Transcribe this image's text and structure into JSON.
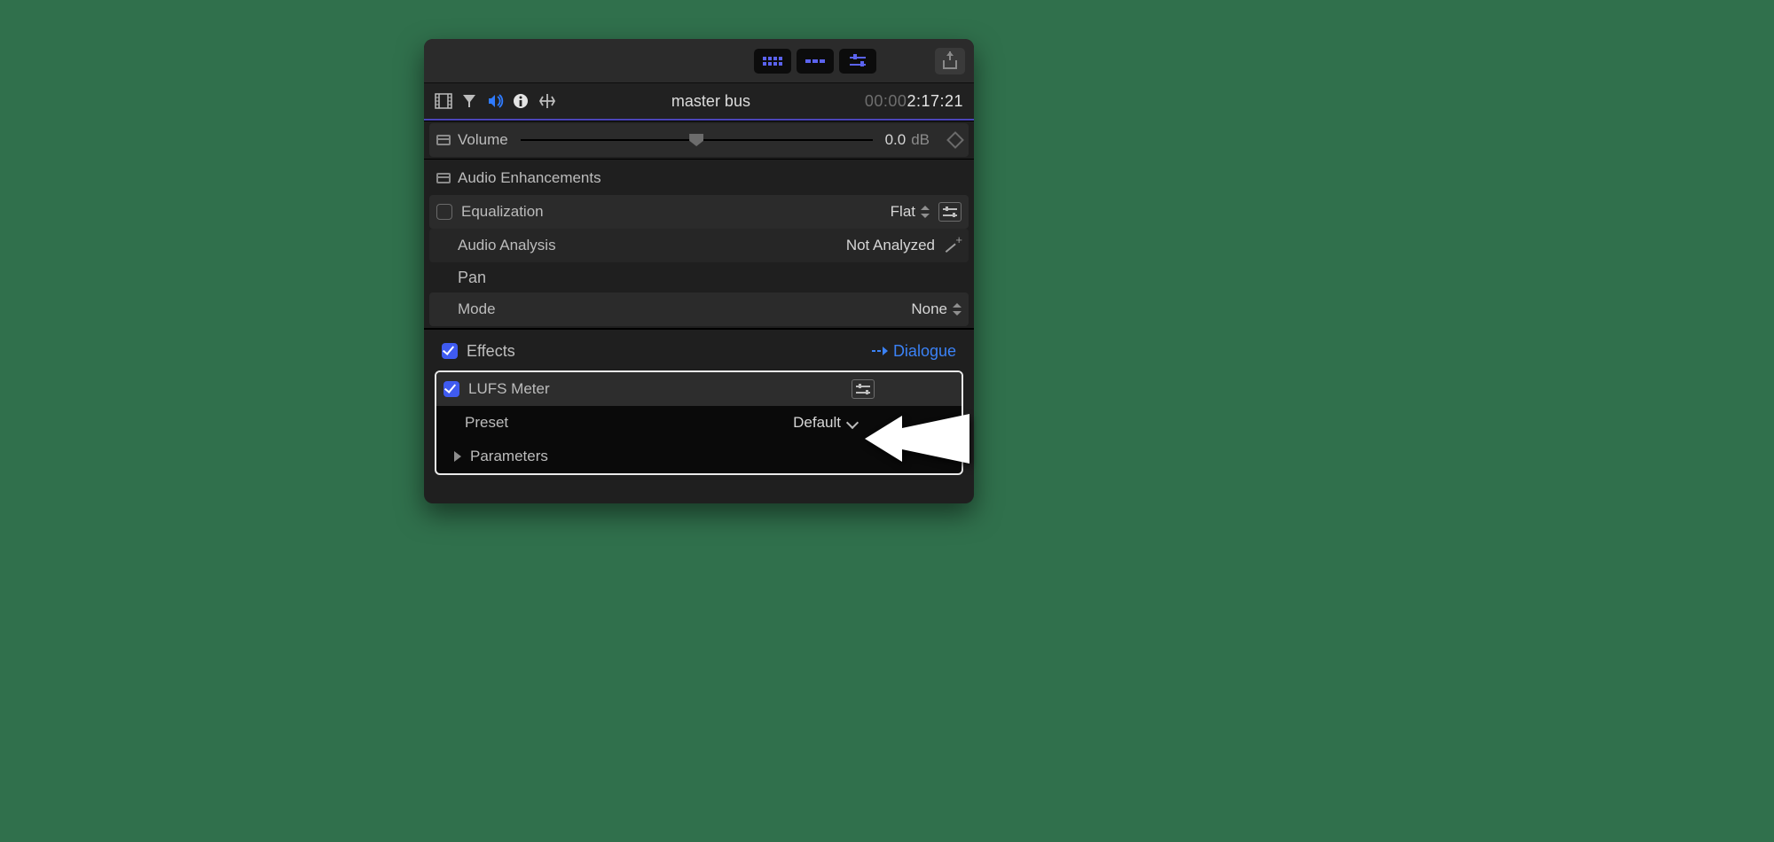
{
  "clip": {
    "title": "master bus",
    "timecode_dim": "00:00",
    "timecode_bright": "2:17:21"
  },
  "volume": {
    "label": "Volume",
    "value": "0.0",
    "unit": "dB"
  },
  "enhancements": {
    "header": "Audio Enhancements",
    "equalization": {
      "label": "Equalization",
      "value": "Flat"
    },
    "analysis": {
      "label": "Audio Analysis",
      "value": "Not Analyzed"
    },
    "pan_header": "Pan",
    "pan_mode": {
      "label": "Mode",
      "value": "None"
    }
  },
  "effects": {
    "header": "Effects",
    "category": "Dialogue",
    "lufs": {
      "label": "LUFS Meter",
      "preset_label": "Preset",
      "preset_value": "Default",
      "params": "Parameters"
    }
  }
}
